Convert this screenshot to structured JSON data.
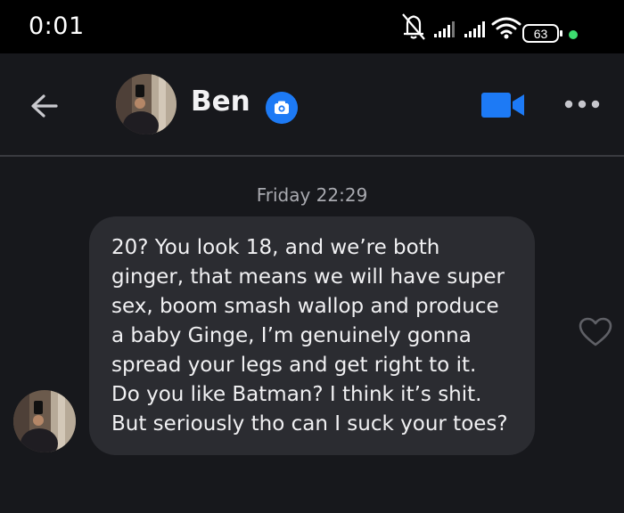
{
  "status_bar": {
    "time": "0:01",
    "battery": "63"
  },
  "header": {
    "contact_name": "Ben",
    "icons": {
      "back": "arrow-left-icon",
      "camera": "camera-icon",
      "video": "video-camera-icon",
      "more": "more-horizontal-icon"
    }
  },
  "conversation": {
    "timestamp": "Friday 22:29",
    "message_lines": [
      "20? You look 18, and we’re both",
      "ginger, that means we will have super",
      "sex, boom smash wallop and produce",
      "a baby Ginge, I’m genuinely gonna",
      "spread your legs and get right to it.",
      "Do you like Batman? I think it’s shit.",
      "But seriously tho can I suck your toes?"
    ],
    "reaction_icon": "heart-outline-icon"
  },
  "colors": {
    "background": "#17181c",
    "bubble": "#2b2c31",
    "accent": "#1d7af5",
    "online": "#3ddc6f"
  }
}
